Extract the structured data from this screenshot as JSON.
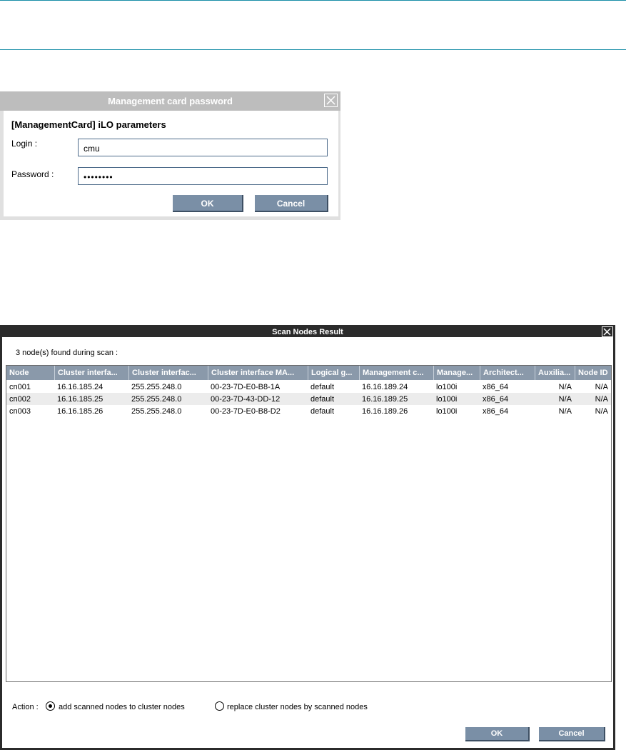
{
  "login_dialog": {
    "title": "Management card password",
    "heading": "[ManagementCard] iLO parameters",
    "login_label": "Login :",
    "login_value": "cmu",
    "password_label": "Password :",
    "password_value": "••••••••",
    "ok_label": "OK",
    "cancel_label": "Cancel"
  },
  "scan_dialog": {
    "title": "Scan Nodes Result",
    "found_text": "3 node(s) found during scan :",
    "columns": [
      "Node",
      "Cluster interfa...",
      "Cluster interfac...",
      "Cluster interface MA...",
      "Logical g...",
      "Management c...",
      "Manage...",
      "Architect...",
      "Auxilia...",
      "Node ID"
    ],
    "rows": [
      [
        "cn001",
        "16.16.185.24",
        "255.255.248.0",
        "00-23-7D-E0-B8-1A",
        "default",
        "16.16.189.24",
        "lo100i",
        "x86_64",
        "N/A",
        "N/A"
      ],
      [
        "cn002",
        "16.16.185.25",
        "255.255.248.0",
        "00-23-7D-43-DD-12",
        "default",
        "16.16.189.25",
        "lo100i",
        "x86_64",
        "N/A",
        "N/A"
      ],
      [
        "cn003",
        "16.16.185.26",
        "255.255.248.0",
        "00-23-7D-E0-B8-D2",
        "default",
        "16.16.189.26",
        "lo100i",
        "x86_64",
        "N/A",
        "N/A"
      ]
    ],
    "action_label": "Action :",
    "option_add": "add scanned nodes to cluster nodes",
    "option_replace": "replace cluster nodes by scanned nodes",
    "selected_option": "add",
    "ok_label": "OK",
    "cancel_label": "Cancel"
  },
  "colors": {
    "rule": "#1a8fa8",
    "header_bg": "#8a99aa",
    "button_bg": "#7a8fa6"
  }
}
